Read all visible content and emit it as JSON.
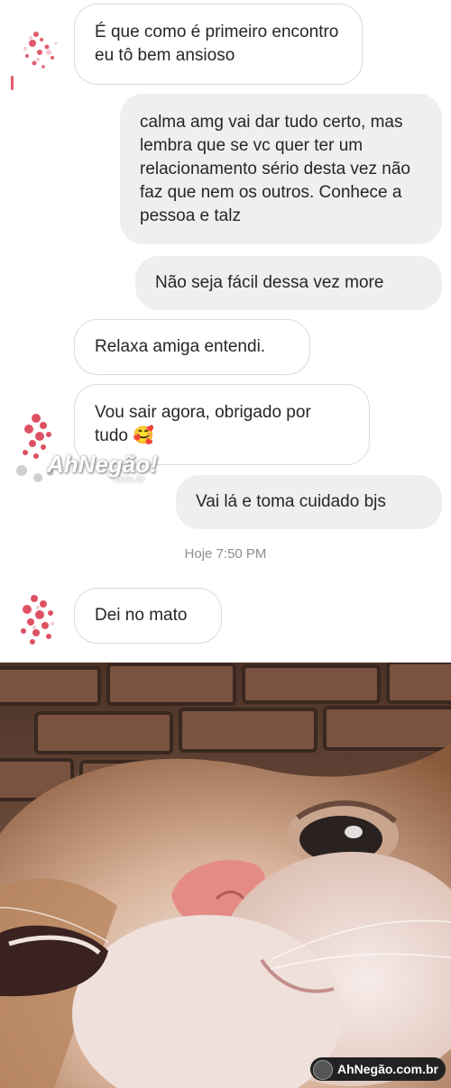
{
  "messages": [
    {
      "side": "in",
      "text": "É que como é primeiro encontro eu tô bem ansioso"
    },
    {
      "side": "out",
      "text": "calma amg vai dar tudo certo, mas lembra que se vc quer ter um relacionamento sério desta vez não faz que nem os outros. Conhece a pessoa e talz"
    },
    {
      "side": "out",
      "text": "Não seja fácil dessa vez more"
    },
    {
      "side": "in",
      "text": "Relaxa amiga entendi."
    },
    {
      "side": "in",
      "text": "Vou sair agora, obrigado por tudo 🥰"
    },
    {
      "side": "out",
      "text": "Vai lá e toma cuidado bjs"
    },
    {
      "side": "in",
      "text": "Dei no mato"
    }
  ],
  "timestamp": "Hoje 7:50 PM",
  "watermark": {
    "chat_logo": "AhNegão!",
    "chat_logo_sub": ".com.br",
    "badge": "AhNegão.com.br"
  },
  "colors": {
    "incoming_border": "#dbdbdb",
    "outgoing_bg": "#efefef",
    "timestamp": "#8e8e8e"
  }
}
